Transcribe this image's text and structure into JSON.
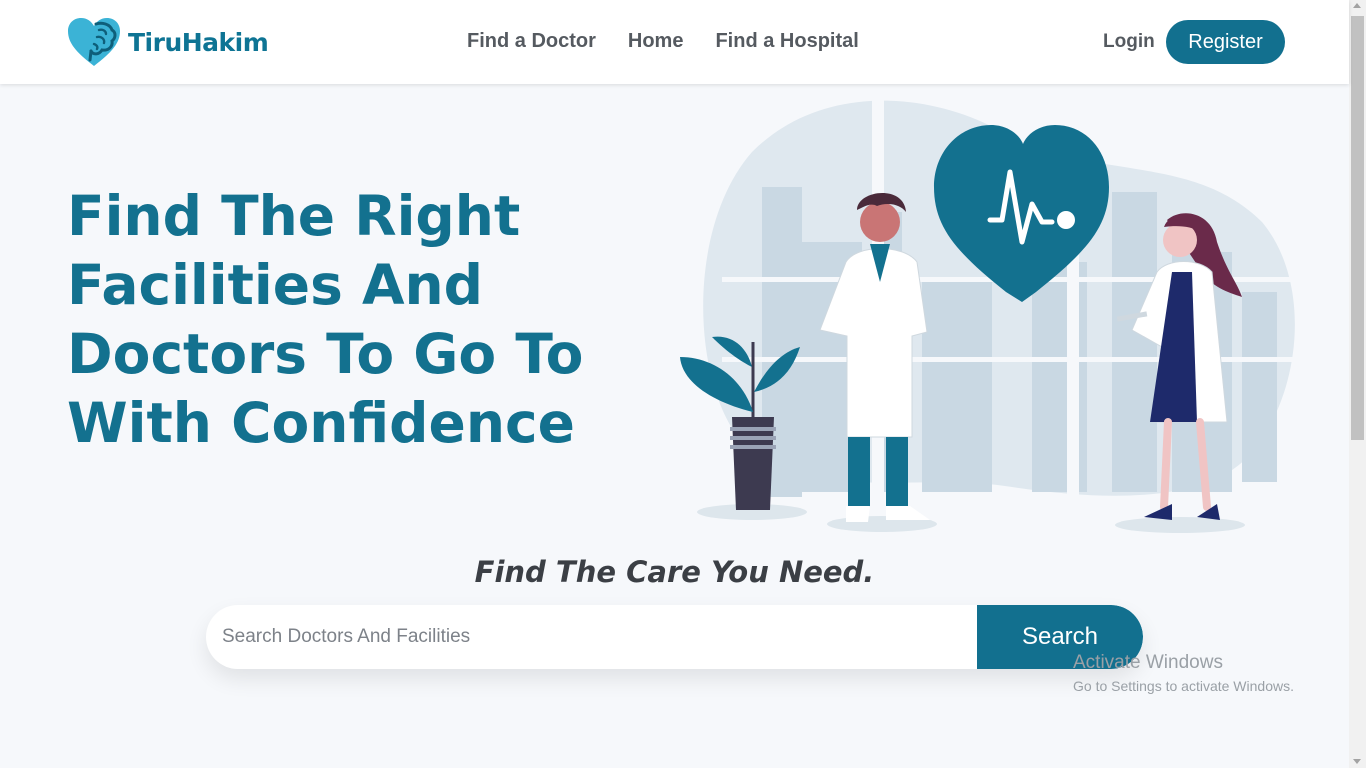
{
  "brand": {
    "name": "TiruHakim",
    "color": "#0e7494"
  },
  "nav": {
    "links": [
      "Find a Doctor",
      "Home",
      "Find a Hospital"
    ],
    "login": "Login",
    "register": "Register"
  },
  "hero": {
    "title_lines": [
      "Find The Right",
      "Facilities And",
      "Doctors To Go To",
      "With Confidence"
    ],
    "illustration_icon": "doctors-heart-illustration"
  },
  "tagline": "Find The Care You Need.",
  "search": {
    "placeholder": "Search Doctors And Facilities",
    "value": "",
    "button": "Search"
  },
  "watermark": {
    "title": "Activate Windows",
    "subtitle": "Go to Settings to activate Windows."
  },
  "colors": {
    "accent": "#12708f",
    "background": "#f6f8fb",
    "text": "#555a60"
  }
}
